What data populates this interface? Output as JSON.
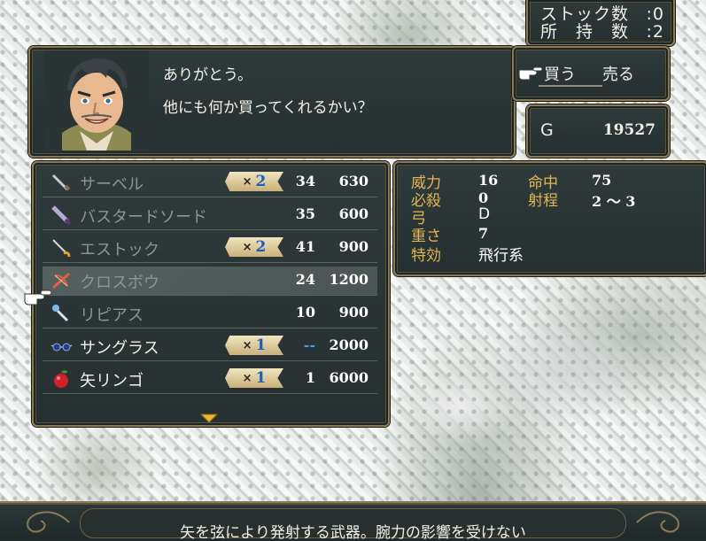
{
  "stock": {
    "label1": "ストック数",
    "value1": "0",
    "label2": "所　持　数",
    "value2": "2"
  },
  "dialog": {
    "line1": "ありがとう。",
    "line2": "他にも何か買ってくれるかい？"
  },
  "shop_mode": {
    "buy": "買う",
    "sell": "売る"
  },
  "gold": {
    "label": "G",
    "amount": "19527"
  },
  "items": [
    {
      "name": "サーベル",
      "qty": "2",
      "uses": "34",
      "price": "630",
      "dim": true
    },
    {
      "name": "バスタードソード",
      "qty": "",
      "uses": "35",
      "price": "600",
      "dim": true
    },
    {
      "name": "エストック",
      "qty": "2",
      "uses": "41",
      "price": "900",
      "dim": true
    },
    {
      "name": "クロスボウ",
      "qty": "",
      "uses": "24",
      "price": "1200",
      "dim": true
    },
    {
      "name": "リピアス",
      "qty": "",
      "uses": "10",
      "price": "900",
      "dim": true
    },
    {
      "name": "サングラス",
      "qty": "1",
      "uses": "--",
      "price": "2000",
      "dim": false
    },
    {
      "name": "矢リンゴ",
      "qty": "1",
      "uses": "1",
      "price": "6000",
      "dim": false
    }
  ],
  "qty_prefix": "×",
  "stats": {
    "power_label": "威力",
    "power": "16",
    "hit_label": "命中",
    "hit": "75",
    "crit_label": "必殺",
    "crit": "0",
    "range_label": "射程",
    "range": "2 ～ 3",
    "type_label": "弓",
    "rank": "D",
    "weight_label": "重さ",
    "weight": "7",
    "effect_label": "特効",
    "effect": "飛行系"
  },
  "description": "矢を弦により発射する武器。腕力の影響を受けない",
  "colors": {
    "panel": "#2f3a3b",
    "border_gold": "#8a7a56",
    "stat_label": "#e4b552",
    "qty_number": "#1a5fc0"
  }
}
